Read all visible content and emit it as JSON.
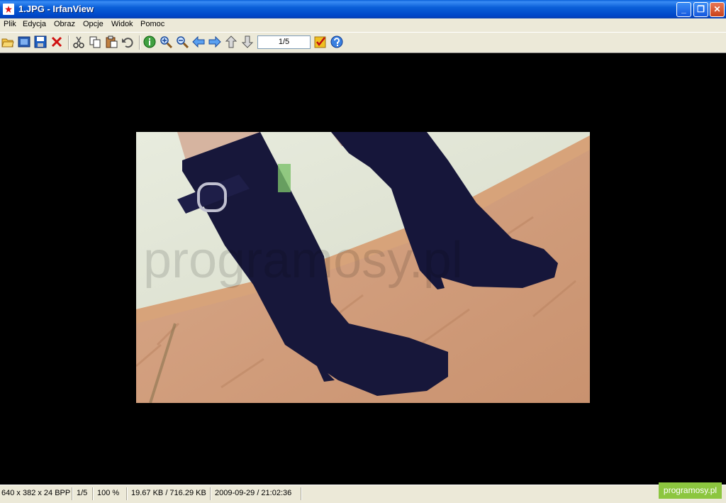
{
  "window": {
    "title": "1.JPG - IrfanView",
    "minimize": "_",
    "maximize": "❐",
    "close": "✕"
  },
  "menu": [
    "Plik",
    "Edycja",
    "Obraz",
    "Opcje",
    "Widok",
    "Pomoc"
  ],
  "toolbar": {
    "icons": [
      "open-folder-icon",
      "slideshow-icon",
      "save-icon",
      "delete-icon",
      "cut-icon",
      "copy-icon",
      "paste-icon",
      "undo-icon",
      "info-icon",
      "zoom-in-icon",
      "zoom-out-icon",
      "previous-icon",
      "next-icon",
      "first-icon",
      "last-icon",
      "properties-icon",
      "help-icon"
    ],
    "page_indicator": "1/5"
  },
  "image": {
    "watermark": "programosy.pl"
  },
  "status": {
    "dimensions": "640 x 382 x 24 BPP",
    "index": "1/5",
    "zoom": "100 %",
    "size": "19.67 KB / 716.29 KB",
    "datetime": "2009-09-29 / 21:02:36"
  },
  "badge": "programosy.pl"
}
